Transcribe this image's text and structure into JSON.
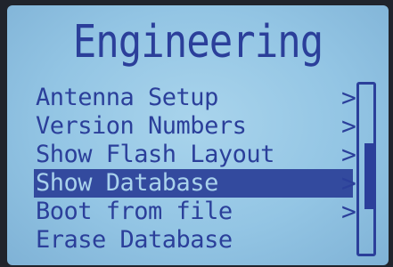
{
  "screen": {
    "title": "Engineering"
  },
  "menu": {
    "items": [
      {
        "label": "Antenna Setup",
        "has_submenu": true,
        "selected": false
      },
      {
        "label": "Version Numbers",
        "has_submenu": true,
        "selected": false
      },
      {
        "label": "Show Flash Layout",
        "has_submenu": true,
        "selected": false
      },
      {
        "label": "Show Database",
        "has_submenu": true,
        "selected": true
      },
      {
        "label": "Boot from file",
        "has_submenu": true,
        "selected": false
      },
      {
        "label": "Erase Database",
        "has_submenu": false,
        "selected": false
      }
    ],
    "chevron": ">"
  },
  "scrollbar": {
    "position_fraction": 0.45
  },
  "colors": {
    "lcd_background": "#93c5e4",
    "text": "#2b3f9a",
    "highlight_background": "#334a9e",
    "highlight_text": "#a9d2ec"
  }
}
